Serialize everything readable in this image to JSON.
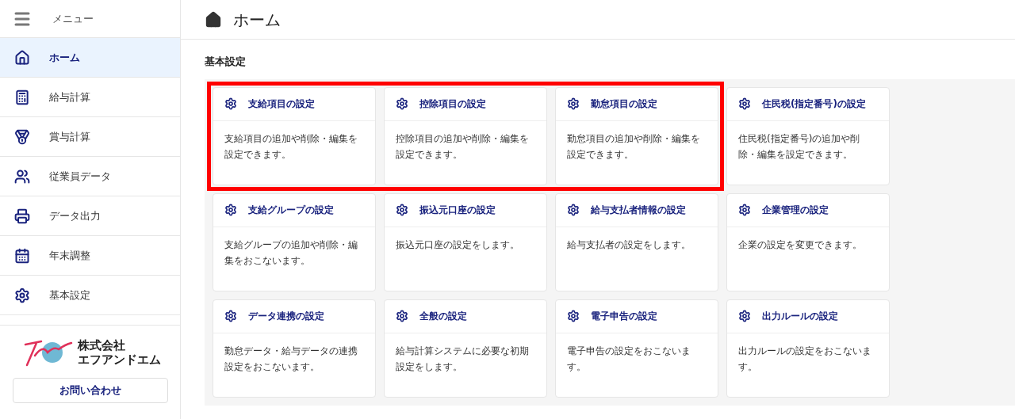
{
  "sidebar": {
    "menu_label": "メニュー",
    "items": [
      {
        "kind": "home",
        "label": "ホーム",
        "selected": true
      },
      {
        "kind": "calculator",
        "label": "給与計算",
        "selected": false
      },
      {
        "kind": "medal",
        "label": "賞与計算",
        "selected": false
      },
      {
        "kind": "users",
        "label": "従業員データ",
        "selected": false
      },
      {
        "kind": "printer",
        "label": "データ出力",
        "selected": false
      },
      {
        "kind": "calendar",
        "label": "年末調整",
        "selected": false
      },
      {
        "kind": "settings",
        "label": "基本設定",
        "selected": false
      }
    ],
    "company": {
      "line_1": "株式会社",
      "line_2": "エフアンドエム"
    },
    "contact_button": "お問い合わせ"
  },
  "header": {
    "title": "ホーム"
  },
  "section": {
    "title": "基本設定",
    "cards": [
      {
        "title": "支給項目の設定",
        "description": "支給項目の追加や削除・編集を設定できます。",
        "highlighted": true
      },
      {
        "title": "控除項目の設定",
        "description": "控除項目の追加や削除・編集を設定できます。",
        "highlighted": true
      },
      {
        "title": "勤怠項目の設定",
        "description": "勤怠項目の追加や削除・編集を設定できます。",
        "highlighted": true
      },
      {
        "title": "住民税(指定番号)の設定",
        "description": "住民税(指定番号)の追加や削除・編集を設定できます。",
        "highlighted": false
      },
      {
        "title": "支給グループの設定",
        "description": "支給グループの追加や削除・編集をおこないます。",
        "highlighted": false
      },
      {
        "title": "振込元口座の設定",
        "description": "振込元口座の設定をします。",
        "highlighted": false
      },
      {
        "title": "給与支払者情報の設定",
        "description": "給与支払者の設定をします。",
        "highlighted": false
      },
      {
        "title": "企業管理の設定",
        "description": "企業の設定を変更できます。",
        "highlighted": false
      },
      {
        "title": "データ連携の設定",
        "description": "勤怠データ・給与データの連携設定をおこないます。",
        "highlighted": false
      },
      {
        "title": "全般の設定",
        "description": "給与計算システムに必要な初期設定をします。",
        "highlighted": false
      },
      {
        "title": "電子申告の設定",
        "description": "電子申告の設定をおこないます。",
        "highlighted": false
      },
      {
        "title": "出力ルールの設定",
        "description": "出力ルールの設定をおこないます。",
        "highlighted": false
      }
    ]
  }
}
